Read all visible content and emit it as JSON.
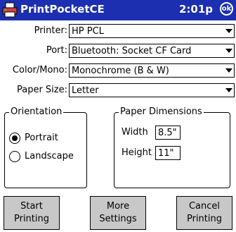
{
  "titlebar": {
    "title": "PrintPocketCE",
    "time": "2:01p",
    "ok_label": "ok"
  },
  "form": {
    "printer": {
      "label": "Printer:",
      "value": "HP PCL"
    },
    "port": {
      "label": "Port:",
      "value": "Bluetooth: Socket CF Card"
    },
    "color_mono": {
      "label": "Color/Mono:",
      "value": "Monochrome (B & W)"
    },
    "paper_size": {
      "label": "Paper Size:",
      "value": "Letter"
    }
  },
  "orientation": {
    "title": "Orientation",
    "portrait": {
      "label": "Portrait",
      "selected": true
    },
    "landscape": {
      "label": "Landscape",
      "selected": false
    }
  },
  "paper_dimensions": {
    "title": "Paper Dimensions",
    "width_label": "Width",
    "width_value": "8.5\"",
    "height_label": "Height",
    "height_value": "11\""
  },
  "buttons": {
    "start": [
      "Start",
      "Printing"
    ],
    "more": [
      "More",
      "Settings"
    ],
    "cancel": [
      "Cancel",
      "Printing"
    ]
  },
  "colors": {
    "titlebar": "#1b2fb0",
    "button_face": "#c8c8c8"
  },
  "icons": {
    "app": "printer-icon",
    "combo": "chevron-down-icon"
  }
}
